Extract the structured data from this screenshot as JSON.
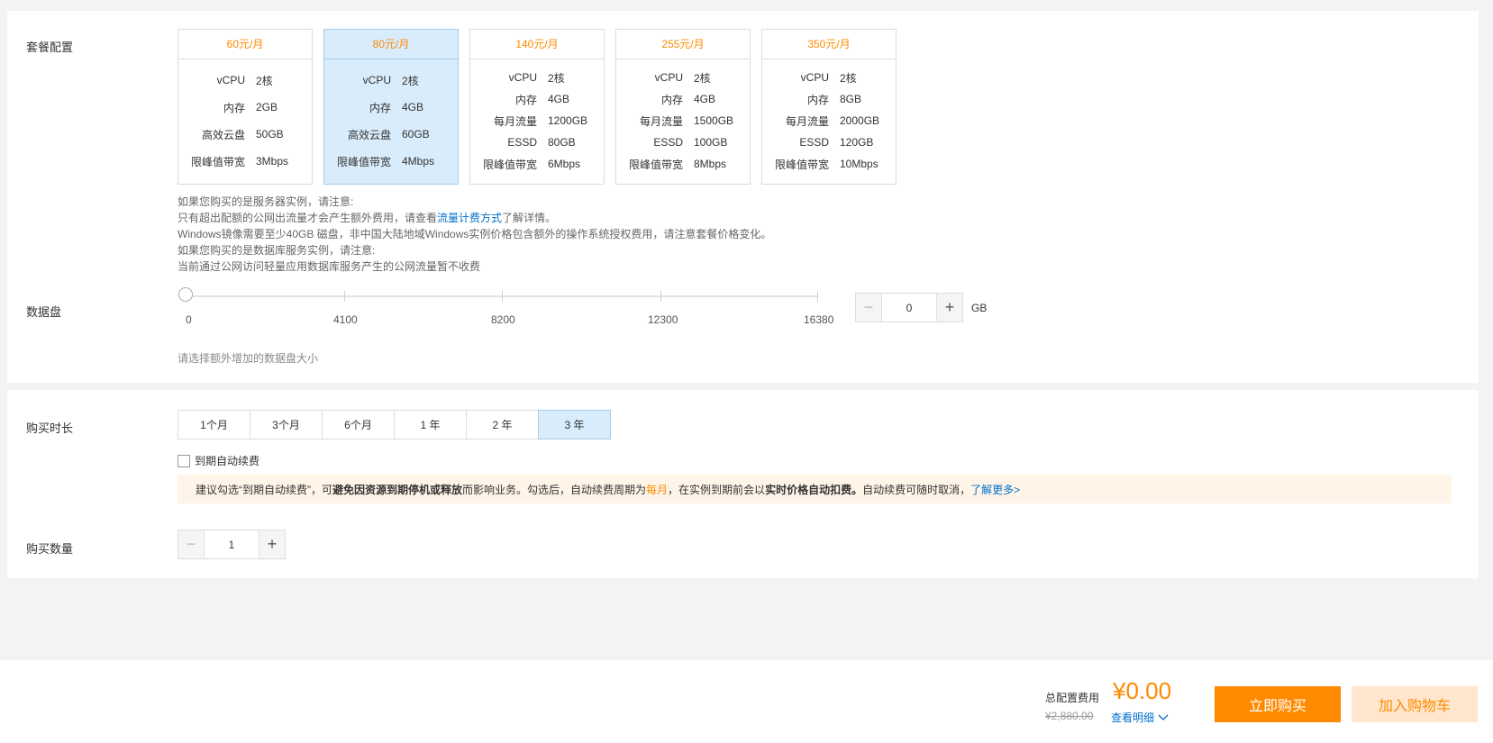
{
  "plan": {
    "label": "套餐配置",
    "cards": [
      {
        "price": "60元/月",
        "specs": [
          {
            "k": "vCPU",
            "v": "2核"
          },
          {
            "k": "内存",
            "v": "2GB"
          },
          {
            "k": "高效云盘",
            "v": "50GB"
          },
          {
            "k": "限峰值带宽",
            "v": "3Mbps"
          }
        ]
      },
      {
        "price": "80元/月",
        "specs": [
          {
            "k": "vCPU",
            "v": "2核"
          },
          {
            "k": "内存",
            "v": "4GB"
          },
          {
            "k": "高效云盘",
            "v": "60GB"
          },
          {
            "k": "限峰值带宽",
            "v": "4Mbps"
          }
        ]
      },
      {
        "price": "140元/月",
        "specs": [
          {
            "k": "vCPU",
            "v": "2核"
          },
          {
            "k": "内存",
            "v": "4GB"
          },
          {
            "k": "每月流量",
            "v": "1200GB"
          },
          {
            "k": "ESSD",
            "v": "80GB"
          },
          {
            "k": "限峰值带宽",
            "v": "6Mbps"
          }
        ]
      },
      {
        "price": "255元/月",
        "specs": [
          {
            "k": "vCPU",
            "v": "2核"
          },
          {
            "k": "内存",
            "v": "4GB"
          },
          {
            "k": "每月流量",
            "v": "1500GB"
          },
          {
            "k": "ESSD",
            "v": "100GB"
          },
          {
            "k": "限峰值带宽",
            "v": "8Mbps"
          }
        ]
      },
      {
        "price": "350元/月",
        "specs": [
          {
            "k": "vCPU",
            "v": "2核"
          },
          {
            "k": "内存",
            "v": "8GB"
          },
          {
            "k": "每月流量",
            "v": "2000GB"
          },
          {
            "k": "ESSD",
            "v": "120GB"
          },
          {
            "k": "限峰值带宽",
            "v": "10Mbps"
          }
        ]
      }
    ],
    "selected_index": 1
  },
  "notes": {
    "line1": "如果您购买的是服务器实例，请注意:",
    "line2_pre": "只有超出配额的公网出流量才会产生额外费用，请查看",
    "line2_link": "流量计费方式",
    "line2_post": "了解详情。",
    "line3": "Windows镜像需要至少40GB 磁盘，非中国大陆地域Windows实例价格包含额外的操作系统授权费用，请注意套餐价格变化。",
    "line4": "如果您购买的是数据库服务实例，请注意:",
    "line5": "当前通过公网访问轻量应用数据库服务产生的公网流量暂不收费"
  },
  "disk": {
    "label": "数据盘",
    "ticks": [
      "0",
      "4100",
      "8200",
      "12300",
      "16380"
    ],
    "value": "0",
    "unit": "GB",
    "hint": "请选择额外增加的数据盘大小"
  },
  "duration": {
    "label": "购买时长",
    "options": [
      "1个月",
      "3个月",
      "6个月",
      "1 年",
      "2 年",
      "3 年"
    ],
    "selected_index": 5,
    "auto_renew_label": "到期自动续费",
    "notice": {
      "p1": "建议勾选“到期自动续费”，可",
      "b1": "避免因资源到期停机或释放",
      "p2": "而影响业务。勾选后，自动续费周期为 ",
      "orange": "每月",
      "p3": "，在实例到期前会以",
      "b2": "实时价格",
      "p4": "自动扣费。",
      "p5": "自动续费可随时取消，",
      "link": "了解更多>"
    }
  },
  "quantity": {
    "label": "购买数量",
    "value": "1"
  },
  "footer": {
    "total_label": "总配置费用",
    "total_price": "¥0.00",
    "original_price": "¥2,880.00",
    "detail_link": "查看明细",
    "buy_button": "立即购买",
    "cart_button": "加入购物车"
  },
  "colors": {
    "accent_orange": "#ff8a00",
    "link_blue": "#0070cc",
    "selected_bg": "#d8ecfb"
  }
}
